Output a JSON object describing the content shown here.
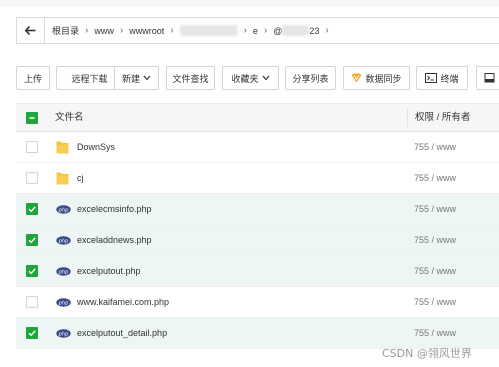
{
  "breadcrumb": {
    "items": [
      "根目录",
      "www",
      "wwwroot",
      "",
      "e",
      "@",
      "23"
    ]
  },
  "toolbar": {
    "upload": "上传",
    "remote_download": "远程下载",
    "new": "新建",
    "file_search": "文件查找",
    "favorites": "收藏夹",
    "share_list": "分享列表",
    "data_sync": "数据同步",
    "terminal": "终端"
  },
  "table": {
    "header_name": "文件名",
    "header_perm": "权限 / 所有者",
    "rows": [
      {
        "name": "DownSys",
        "perm": "755 / www",
        "type": "folder",
        "checked": false
      },
      {
        "name": "cj",
        "perm": "755 / www",
        "type": "folder",
        "checked": false
      },
      {
        "name": "excelecmsinfo.php",
        "perm": "755 / www",
        "type": "php",
        "checked": true
      },
      {
        "name": "exceladdnews.php",
        "perm": "755 / www",
        "type": "php",
        "checked": true
      },
      {
        "name": "excelputout.php",
        "perm": "755 / www",
        "type": "php",
        "checked": true
      },
      {
        "name": "www.kaifamei.com.php",
        "perm": "755 / www",
        "type": "php",
        "checked": false
      },
      {
        "name": "excelputout_detail.php",
        "perm": "755 / www",
        "type": "php",
        "checked": true
      }
    ]
  },
  "watermark": "CSDN @翎风世界",
  "colors": {
    "accent": "#20a53a",
    "selected_row": "#edf6f4",
    "folder": "#f5c139",
    "php_badge": "#3a4a86"
  }
}
